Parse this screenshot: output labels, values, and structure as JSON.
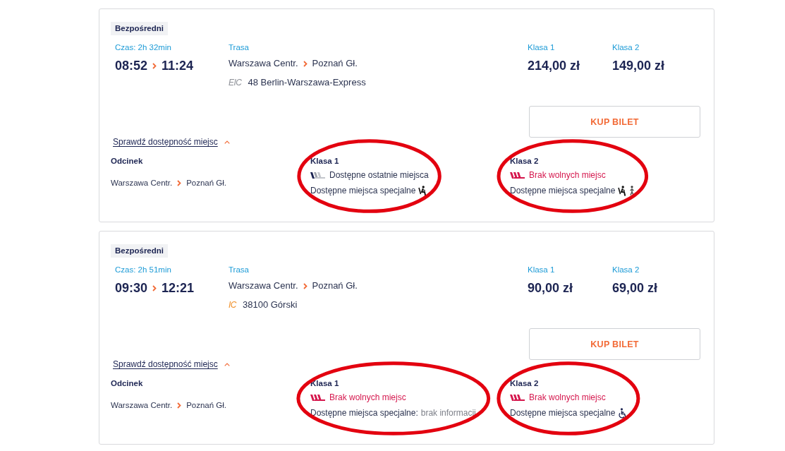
{
  "results": [
    {
      "badge": "Bezpośredni",
      "duration": "Czas: 2h 32min",
      "departure": "08:52",
      "arrival": "11:24",
      "route_label": "Trasa",
      "route": {
        "from": "Warszawa Centr.",
        "to": "Poznań Gł."
      },
      "train": {
        "carrier": "EIC",
        "color": "#8e9198",
        "name": "48 Berlin-Warszawa-Express"
      },
      "prices": [
        {
          "label": "Klasa 1",
          "price": "214,00 zł"
        },
        {
          "label": "Klasa 2",
          "price": "149,00 zł"
        }
      ],
      "buy_button": "KUP BILET",
      "availability": {
        "toggle": "Sprawdź dostępność miejsc",
        "expanded": true,
        "segment_header": "Odcinek",
        "segments": [
          {
            "from": "Warszawa Centr.",
            "to": "Poznań Gł."
          }
        ],
        "classes": [
          {
            "name": "Klasa 1",
            "kind": "last",
            "status_text": "Dostępne ostatnie miejsca",
            "special_label": "Dostępne miejsca specjalne",
            "special_icons": [
              {
                "kind": "seat"
              }
            ],
            "circled": true
          },
          {
            "name": "Klasa 2",
            "kind": "none",
            "status_text": "Brak wolnych miejsc",
            "special_label": "Dostępne miejsca specjalne",
            "special_icons": [
              {
                "kind": "seat"
              },
              {
                "kind": "person"
              }
            ],
            "circled": true
          }
        ]
      }
    },
    {
      "badge": "Bezpośredni",
      "duration": "Czas: 2h 51min",
      "departure": "09:30",
      "arrival": "12:21",
      "route_label": "Trasa",
      "route": {
        "from": "Warszawa Centr.",
        "to": "Poznań Gł."
      },
      "train": {
        "carrier": "IC",
        "color": "#f0902a",
        "name": "38100 Górski"
      },
      "prices": [
        {
          "label": "Klasa 1",
          "price": "90,00 zł"
        },
        {
          "label": "Klasa 2",
          "price": "69,00 zł"
        }
      ],
      "buy_button": "KUP BILET",
      "availability": {
        "toggle": "Sprawdź dostępność miejsc",
        "expanded": true,
        "segment_header": "Odcinek",
        "segments": [
          {
            "from": "Warszawa Centr.",
            "to": "Poznań Gł."
          }
        ],
        "classes": [
          {
            "name": "Klasa 1",
            "kind": "none",
            "status_text": "Brak wolnych miejsc",
            "special_label": "Dostępne miejsca specjalne:",
            "special_note": "brak informacji",
            "circled": true
          },
          {
            "name": "Klasa 2",
            "kind": "none",
            "status_text": "Brak wolnych miejsc",
            "special_label": "Dostępne miejsca specjalne",
            "special_icons": [
              {
                "kind": "wheelchair"
              }
            ],
            "circled": true
          }
        ]
      }
    }
  ]
}
